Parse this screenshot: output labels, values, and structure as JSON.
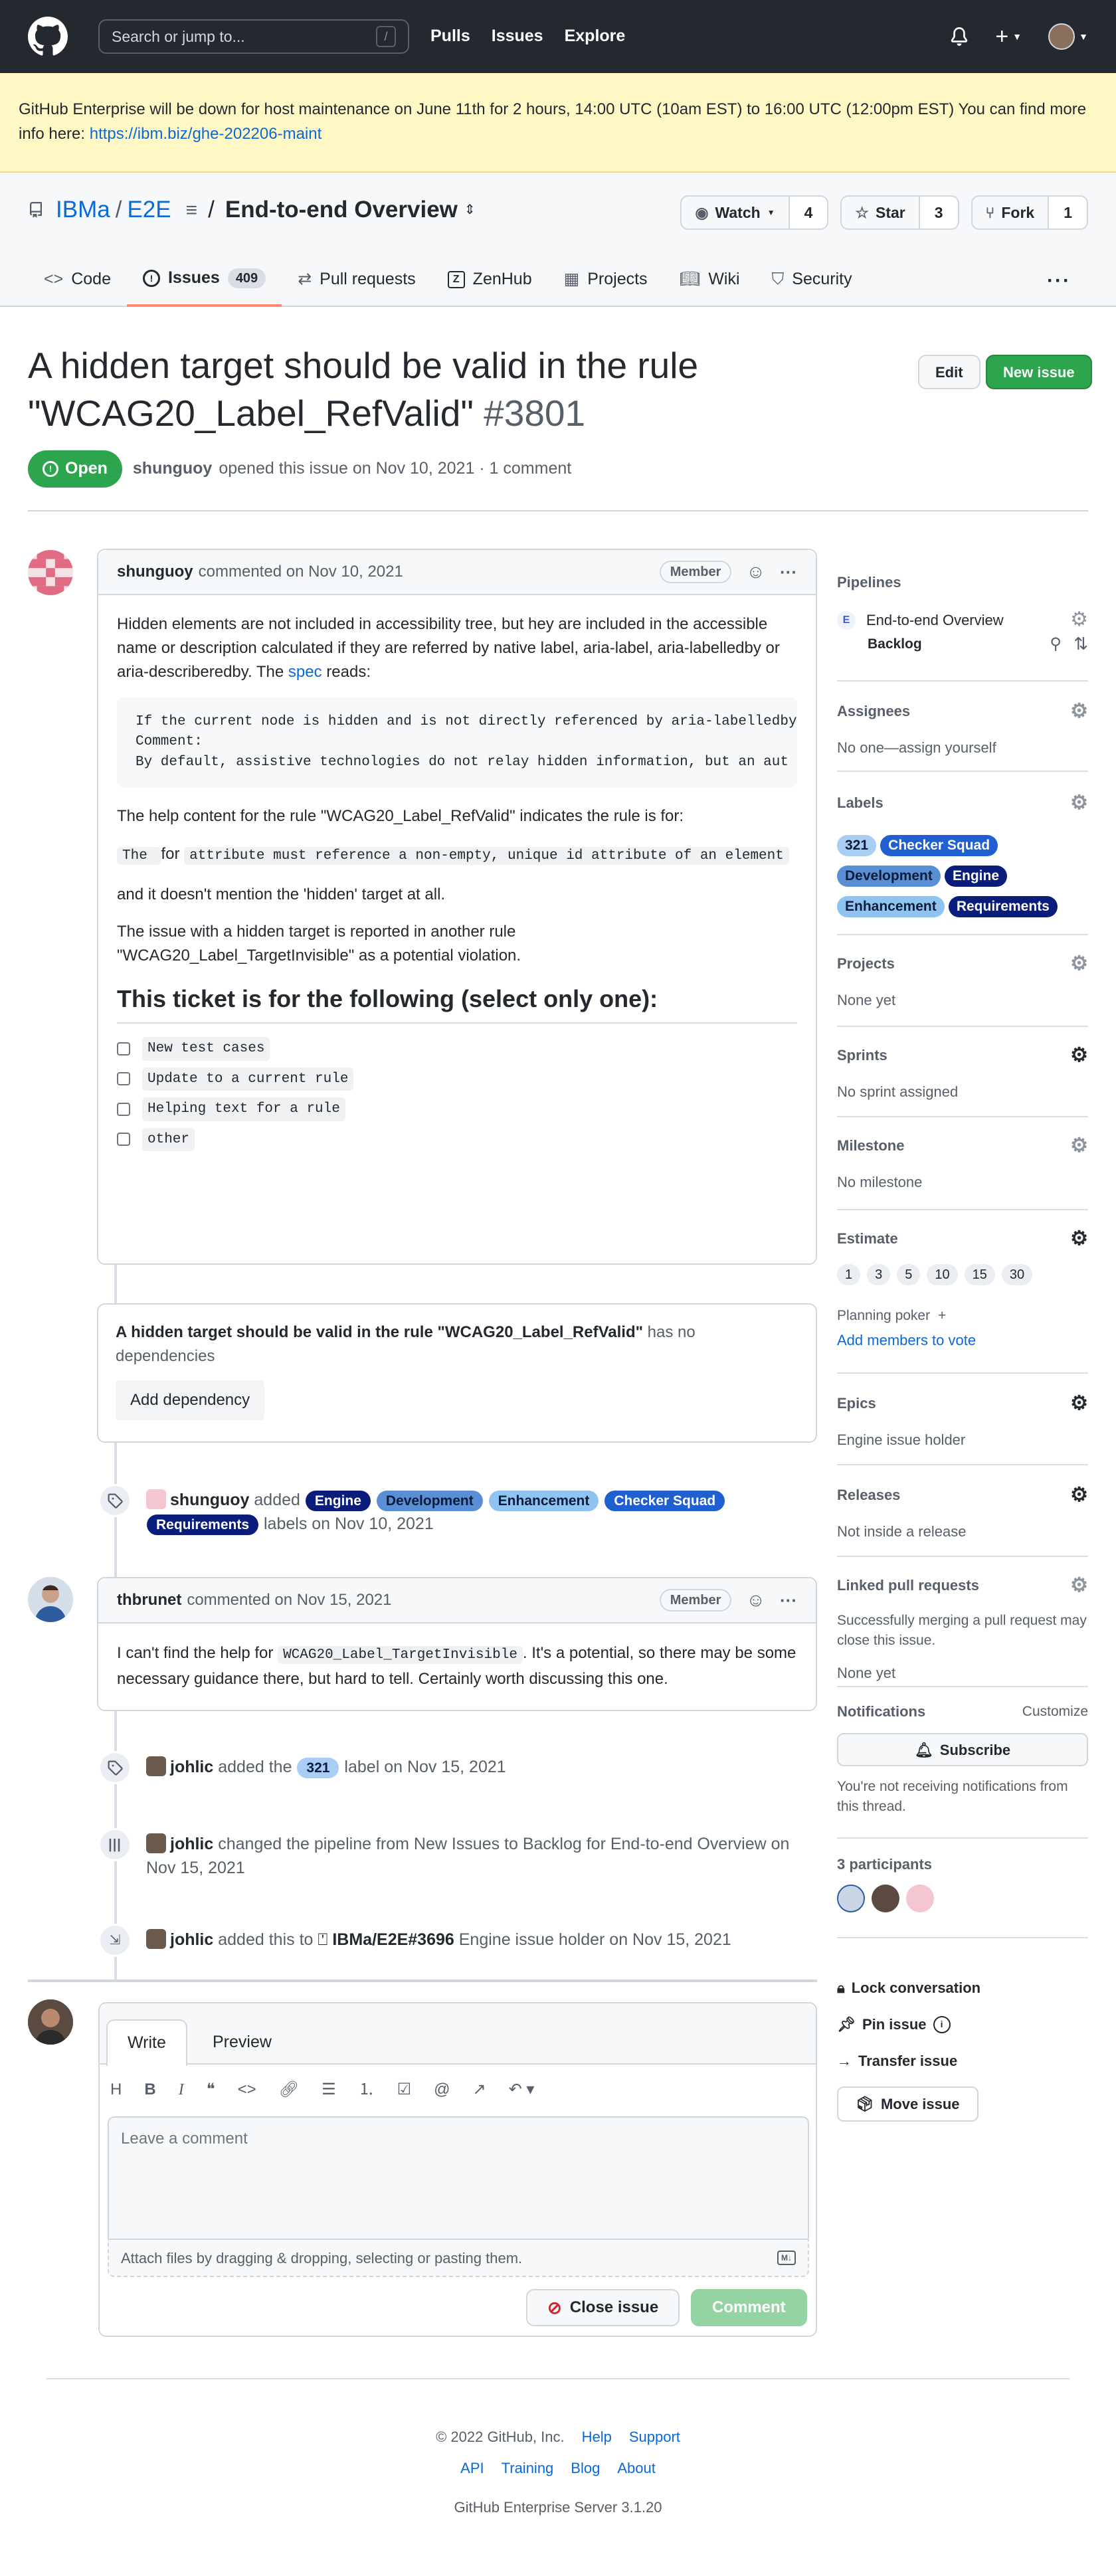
{
  "header": {
    "search_placeholder": "Search or jump to...",
    "search_shortcut": "/",
    "nav": [
      "Pulls",
      "Issues",
      "Explore"
    ]
  },
  "banner": {
    "text": "GitHub Enterprise will be down for host maintenance on June 11th for 2 hours, 14:00 UTC (10am EST) to 16:00 UTC (12:00pm EST) You can find more info here: ",
    "link": "https://ibm.biz/ghe-202206-maint"
  },
  "repo": {
    "owner": "IBMa",
    "sep": "/",
    "name": "E2E",
    "project_sep": "/",
    "project": "End-to-end Overview",
    "watch_label": "Watch",
    "watch_count": "4",
    "star_label": "Star",
    "star_count": "3",
    "fork_label": "Fork",
    "fork_count": "1"
  },
  "tabs": [
    {
      "label": "Code"
    },
    {
      "label": "Issues",
      "count": "409"
    },
    {
      "label": "Pull requests"
    },
    {
      "label": "ZenHub"
    },
    {
      "label": "Projects"
    },
    {
      "label": "Wiki"
    },
    {
      "label": "Security"
    }
  ],
  "issue": {
    "title": "A hidden target should be valid in the rule \"WCAG20_Label_RefValid\"",
    "number": "#3801",
    "edit_label": "Edit",
    "new_label": "New issue",
    "state": "Open",
    "author": "shunguoy",
    "meta": "opened this issue on Nov 10, 2021 · 1 comment"
  },
  "comment1": {
    "author": "shunguoy",
    "when": "commented on Nov 10, 2021",
    "role": "Member",
    "p1a": "Hidden elements are not included in accessibility tree, but hey are included in the accessible name or description calculated if they are referred by native label, aria-label, aria-labelledby or aria-describeredby. The ",
    "p1link": "spec",
    "p1b": " reads:",
    "quote": "If the current node is hidden and is not directly referenced by aria-labelledby\nComment:\nBy default, assistive technologies do not relay hidden information, but an aut",
    "p2": "The help content for the rule \"WCAG20_Label_RefValid\" indicates the rule is for:",
    "p3a": "The ",
    "p3b": " for ",
    "p3c": "attribute must reference a non-empty, unique id attribute of an element",
    "p4": "and it doesn't mention the 'hidden' target at all.",
    "p5": "The issue with a hidden target is reported in another rule \"WCAG20_Label_TargetInvisible\" as a potential violation.",
    "heading": "This ticket is for the following (select only one):",
    "tasks": [
      "New test cases",
      "Update to a current rule",
      "Helping text for a rule",
      "other"
    ]
  },
  "dependency": {
    "title": "A hidden target should be valid in the rule \"WCAG20_Label_RefValid\"",
    "suffix": " has no dependencies",
    "button": "Add dependency"
  },
  "event_labels": {
    "user": "shunguoy",
    "verb": "added",
    "labels": [
      {
        "name": "Engine",
        "bg": "#0b1d7a",
        "fg": "#ffffff"
      },
      {
        "name": "Development",
        "bg": "#5a8fd6",
        "fg": "#0b1d3a"
      },
      {
        "name": "Enhancement",
        "bg": "#8fc3f2",
        "fg": "#0b1d3a"
      },
      {
        "name": "Checker Squad",
        "bg": "#1f5fcf",
        "fg": "#ffffff"
      },
      {
        "name": "Requirements",
        "bg": "#0b1d7a",
        "fg": "#ffffff"
      }
    ],
    "suffix": "labels on Nov 10, 2021"
  },
  "comment2": {
    "author": "thbrunet",
    "when": "commented on Nov 15, 2021",
    "role": "Member",
    "text_a": "I can't find the help for ",
    "code": "WCAG20_Label_TargetInvisible",
    "text_b": ". It's a potential, so there may be some necessary guidance there, but hard to tell. Certainly worth discussing this one."
  },
  "event_321": {
    "user": "johlic",
    "pre": "added the",
    "label": "321",
    "post": "label on Nov 15, 2021"
  },
  "event_pipeline": {
    "user": "johlic",
    "text": "changed the pipeline from New Issues to Backlog for End-to-end Overview on Nov 15, 2021"
  },
  "event_epic": {
    "user": "johlic",
    "pre": "added this to",
    "ref": "IBMa/E2E#3696",
    "post": "Engine issue holder on Nov 15, 2021"
  },
  "editor": {
    "tab_write": "Write",
    "tab_preview": "Preview",
    "placeholder": "Leave a comment",
    "attach": "Attach files by dragging & dropping, selecting or pasting them.",
    "close_label": "Close issue",
    "comment_label": "Comment"
  },
  "sidebar": {
    "pipelines": {
      "title": "Pipelines",
      "board": "End-to-end Overview",
      "column": "Backlog",
      "badge": "E"
    },
    "assignees": {
      "title": "Assignees",
      "value": "No one—assign yourself"
    },
    "labels": {
      "title": "Labels",
      "items": [
        {
          "name": "321",
          "bg": "#a9cdf5",
          "fg": "#0b1d3a"
        },
        {
          "name": "Checker Squad",
          "bg": "#1f5fcf",
          "fg": "#ffffff"
        },
        {
          "name": "Development",
          "bg": "#5a8fd6",
          "fg": "#0b1d3a"
        },
        {
          "name": "Engine",
          "bg": "#0b1d7a",
          "fg": "#ffffff"
        },
        {
          "name": "Enhancement",
          "bg": "#8fc3f2",
          "fg": "#0b1d3a"
        },
        {
          "name": "Requirements",
          "bg": "#0b1d7a",
          "fg": "#ffffff"
        }
      ]
    },
    "projects": {
      "title": "Projects",
      "value": "None yet"
    },
    "sprints": {
      "title": "Sprints",
      "value": "No sprint assigned"
    },
    "milestone": {
      "title": "Milestone",
      "value": "No milestone"
    },
    "estimate": {
      "title": "Estimate",
      "values": [
        "1",
        "3",
        "5",
        "10",
        "15",
        "30"
      ],
      "poker": "Planning poker",
      "poker_plus": "+",
      "vote": "Add members to vote"
    },
    "epics": {
      "title": "Epics",
      "value": "Engine issue holder"
    },
    "releases": {
      "title": "Releases",
      "value": "Not inside a release"
    },
    "linked": {
      "title": "Linked pull requests",
      "desc": "Successfully merging a pull request may close this issue.",
      "value": "None yet"
    },
    "notifications": {
      "title": "Notifications",
      "customize": "Customize",
      "button": "Subscribe",
      "desc": "You're not receiving notifications from this thread."
    },
    "participants": {
      "title": "3 participants"
    },
    "actions": [
      "Lock conversation",
      "Pin issue",
      "Transfer issue",
      "Move issue"
    ]
  },
  "footer": {
    "copyright": "© 2022 GitHub, Inc.",
    "links1": [
      "Help",
      "Support"
    ],
    "links2": [
      "API",
      "Training",
      "Blog",
      "About"
    ],
    "server": "GitHub Enterprise Server 3.1.20"
  }
}
